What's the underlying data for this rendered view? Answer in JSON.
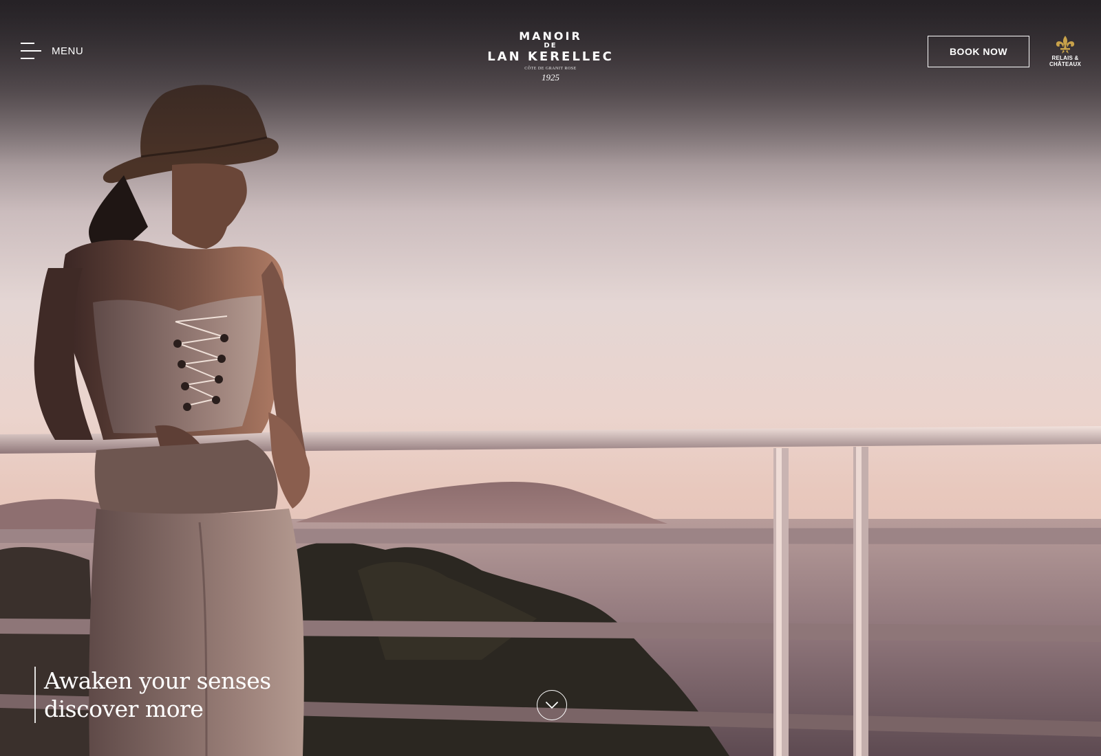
{
  "header": {
    "menu_label": "MENU",
    "book_label": "BOOK NOW",
    "logo": {
      "line1": "MANOIR",
      "line2": "DE",
      "line3": "LAN KERELLEC",
      "tagline": "CÔTE DE GRANIT ROSE",
      "year": "1925"
    },
    "partner_badge": {
      "line1": "RELAIS &",
      "line2": "CHÂTEAUX",
      "icon": "fleur-de-lis-icon",
      "color": "#c8a24a"
    }
  },
  "hero": {
    "caption_line1": "Awaken your senses",
    "caption_line2": "discover more",
    "scroll_icon": "chevron-down-icon"
  }
}
